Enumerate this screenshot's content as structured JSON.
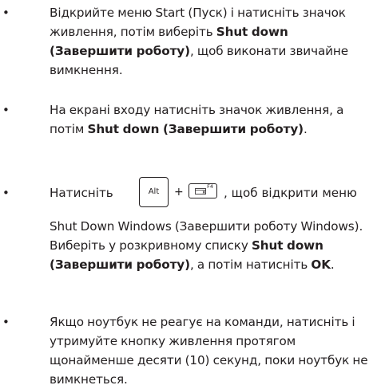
{
  "bullets": {
    "symbol": "•"
  },
  "item1": {
    "text_a": "Відкрийте меню Start (Пуск) і натисніть значок живлення, потім виберіть ",
    "bold_a": "Shut down (Завершити роботу)",
    "text_b": ", щоб виконати звичайне вимкнення."
  },
  "item2": {
    "text_a": "На екрані входу натисніть значок живлення, а потім ",
    "bold_a": "Shut down (Завершити роботу)",
    "text_b": "."
  },
  "item3": {
    "text_before_keys": "Натисніть",
    "key_alt": "Alt",
    "plus": "+",
    "key_f4": "F4",
    "text_after_keys": ", щоб відкрити меню",
    "text_a": "Shut Down Windows (Завершити роботу Windows). Виберіть у розкривному списку ",
    "bold_a": "Shut down (Завершити роботу)",
    "text_b": ", а потім натисніть ",
    "bold_b": "OK",
    "text_c": "."
  },
  "item4": {
    "text_a": "Якщо ноутбук не реагує на команди, натисніть і утримуйте кнопку живлення протягом щонайменше десяти (10) секунд, поки ноутбук не вимкнеться."
  }
}
